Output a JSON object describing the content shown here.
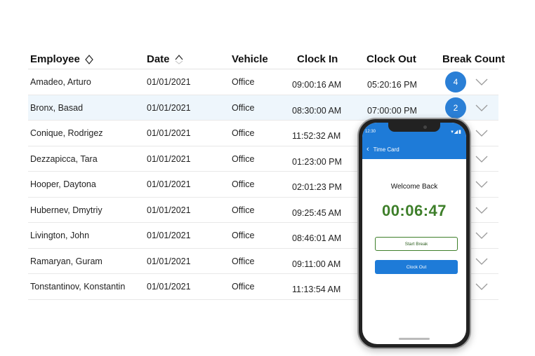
{
  "table": {
    "headers": {
      "employee": "Employee",
      "date": "Date",
      "vehicle": "Vehicle",
      "clock_in": "Clock In",
      "clock_out": "Clock Out",
      "break_count": "Break Count"
    },
    "rows": [
      {
        "employee": "Amadeo, Arturo",
        "date": "01/01/2021",
        "vehicle": "Office",
        "clock_in": "09:00:16 AM",
        "clock_out": "05:20:16 PM",
        "break_count": "4"
      },
      {
        "employee": "Bronx, Basad",
        "date": "01/01/2021",
        "vehicle": "Office",
        "clock_in": "08:30:00 AM",
        "clock_out": "07:00:00 PM",
        "break_count": "2"
      },
      {
        "employee": "Conique, Rodrigez",
        "date": "01/01/2021",
        "vehicle": "Office",
        "clock_in": "11:52:32 AM"
      },
      {
        "employee": "Dezzapicca, Tara",
        "date": "01/01/2021",
        "vehicle": "Office",
        "clock_in": "01:23:00 PM"
      },
      {
        "employee": "Hooper, Daytona",
        "date": "01/01/2021",
        "vehicle": "Office",
        "clock_in": "02:01:23 PM"
      },
      {
        "employee": "Hubernev, Dmytriy",
        "date": "01/01/2021",
        "vehicle": "Office",
        "clock_in": "09:25:45 AM"
      },
      {
        "employee": "Livington, John",
        "date": "01/01/2021",
        "vehicle": "Office",
        "clock_in": "08:46:01 AM"
      },
      {
        "employee": "Ramaryan, Guram",
        "date": "01/01/2021",
        "vehicle": "Office",
        "clock_in": "09:11:00 AM"
      },
      {
        "employee": "Tonstantinov, Konstantin",
        "date": "01/01/2021",
        "vehicle": "Office",
        "clock_in": "11:13:54 AM"
      }
    ],
    "highlighted_row": 1
  },
  "phone": {
    "status_time": "12:30",
    "appbar_title": "Time Card",
    "welcome": "Welcome Back",
    "timer": "00:06:47",
    "start_break_label": "Start Break",
    "clock_out_label": "Clock Out"
  },
  "colors": {
    "accent_blue": "#1e7bd8",
    "badge_blue": "#2a7fd6",
    "timer_green": "#3e7f2a",
    "highlight_row": "#eef6fc"
  }
}
